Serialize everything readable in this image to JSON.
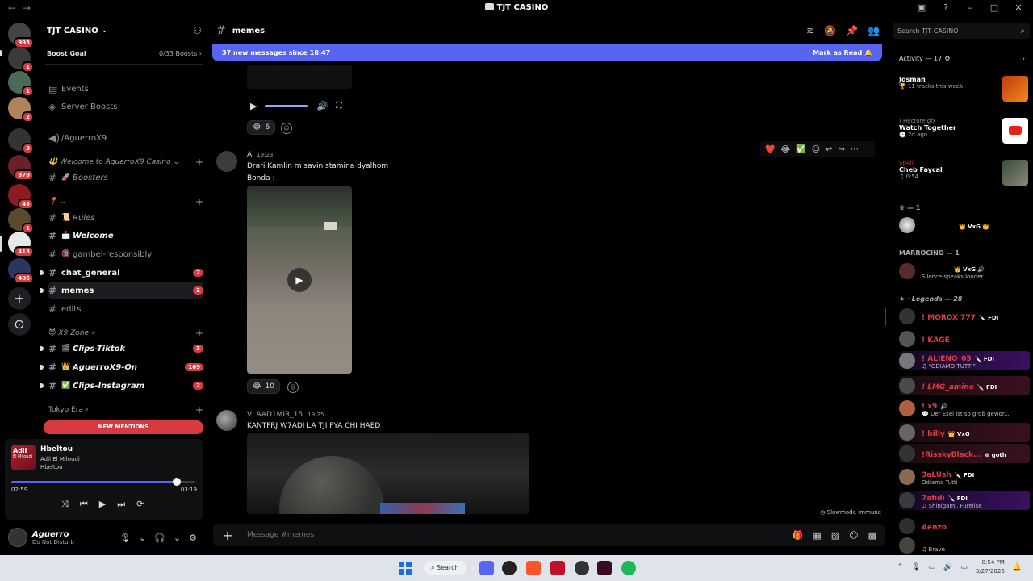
{
  "window": {
    "title": "TJT CASINO",
    "nav_back": "←",
    "nav_fwd": "→"
  },
  "servers": [
    {
      "badge": "993"
    },
    {
      "badge": "1"
    },
    {
      "badge": "1"
    },
    {
      "badge": "2"
    },
    {
      "badge": "3"
    },
    {
      "badge": "879"
    },
    {
      "badge": "43"
    },
    {
      "badge": "1"
    },
    {
      "badge": "413"
    },
    {
      "badge": "405"
    }
  ],
  "guild": {
    "name": "TJT CASINO",
    "boost_goal": "Boost Goal",
    "boost_count": "0/33 Boosts",
    "events": "Events",
    "server_boosts": "Server Boosts",
    "voice_channel": "/AguerroX9"
  },
  "categories": {
    "welcome": "Welcome to AguerroX9 Casino",
    "pin": "📍",
    "x9zone": "X9 Zone",
    "tokyo": "Tokyo Era"
  },
  "channels": [
    {
      "label": "Boosters",
      "emoji": "🚀"
    },
    {
      "label": "Rules",
      "emoji": "📜"
    },
    {
      "label": "Welcome",
      "emoji": "📩"
    },
    {
      "label": "gambel-responsibly",
      "emoji": "🔞"
    },
    {
      "label": "chat_general",
      "badge": "2"
    },
    {
      "label": "memes",
      "badge": "2"
    },
    {
      "label": "edits"
    },
    {
      "label": "Clips-Tiktok",
      "emoji": "🎬",
      "badge": "3"
    },
    {
      "label": "AguerroX9-On",
      "emoji": "👑",
      "badge": "169"
    },
    {
      "label": "Clips-Instagram",
      "emoji": "✅",
      "badge": "2"
    }
  ],
  "new_mentions": "NEW MENTIONS",
  "player": {
    "art_label": "Adil",
    "art_sub": "El Miloudi",
    "song": "Hbeltou",
    "artist": "Adil El Miloudi",
    "album": "Hbeltou",
    "elapsed": "02:59",
    "duration": "03:19",
    "progress": 0.9
  },
  "user": {
    "name": "Aguerro",
    "status": "Do Not Disturb"
  },
  "channel_header": {
    "name": "memes"
  },
  "banner": {
    "text": "37 new messages since 18:47",
    "action": "Mark as Read"
  },
  "messages": [
    {
      "reaction": {
        "emoji": "😂",
        "count": "6"
      }
    },
    {
      "author": "A",
      "time": "19:23",
      "lines": [
        "Drari Kamlin m savin stamina dyalhom",
        "Bonda :"
      ],
      "reaction": {
        "emoji": "😂",
        "count": "10"
      }
    },
    {
      "author": "VLAAD1MIR_15",
      "time": "19:25",
      "lines": [
        "KANTFRJ W7ADI LA TJI FYA CHI HAED"
      ]
    }
  ],
  "hover_toolbar": {
    "r1": "❤️",
    "r2": "😂",
    "r3": "✅"
  },
  "composer": {
    "placeholder": "Message #memes"
  },
  "slowmode": "Slowmode Immune",
  "members_panel": {
    "search_placeholder": "Search TJT CASINO",
    "activity_title": "Activity — 17",
    "activities": [
      {
        "name": "Josman",
        "sub": "11 tracks this week",
        "user": ""
      },
      {
        "name": "Watch Together",
        "sub": "2d ago",
        "user": "Hectore.gfx"
      },
      {
        "name": "Cheb Faycal",
        "sub": "0:54",
        "user": "Sb4ll"
      }
    ],
    "groups": [
      {
        "label": "— 1"
      },
      {
        "label": "MARROCINO — 1"
      },
      {
        "label": "Legends — 28"
      }
    ],
    "members": [
      {
        "name": "",
        "tag": "VxG",
        "status": "",
        "color": "#dbdee1"
      },
      {
        "name": "",
        "tag": "VxG",
        "status": "Silence speaks louder",
        "color": "#dbdee1"
      },
      {
        "name": "! MOROX 777",
        "tag": "FDI",
        "status": "",
        "color": "#e03a45"
      },
      {
        "name": "! KAGE",
        "tag": "",
        "status": "",
        "color": "#e03a45"
      },
      {
        "name": "! ALIENO_05",
        "tag": "FDI",
        "status": "“ODIAMO TUTTI”",
        "color": "#e03a45"
      },
      {
        "name": "! LMG_amine",
        "tag": "FDI",
        "status": "",
        "color": "#e03a45"
      },
      {
        "name": "! x9",
        "tag": "",
        "status": "Der Esel ist so groß gewor...",
        "color": "#e03a45"
      },
      {
        "name": "! billy",
        "tag": "VxG",
        "status": "",
        "color": "#e03a45"
      },
      {
        "name": "!RisskyBlack...",
        "tag": "goth",
        "status": "",
        "color": "#e03a45"
      },
      {
        "name": "3aLUsh",
        "tag": "FDI",
        "status": "Odiamo Tutti",
        "color": "#e03a45"
      },
      {
        "name": "7afidi",
        "tag": "FDI",
        "status": "Shinigami, Furelise",
        "color": "#e03a45"
      },
      {
        "name": "Aenzo",
        "tag": "",
        "status": "",
        "color": "#e03a45"
      },
      {
        "name": "",
        "tag": "",
        "status": "Brave",
        "color": "#e03a45"
      }
    ]
  },
  "taskbar": {
    "search": "Search",
    "time": "8:54 PM",
    "date": "3/27/2026"
  }
}
